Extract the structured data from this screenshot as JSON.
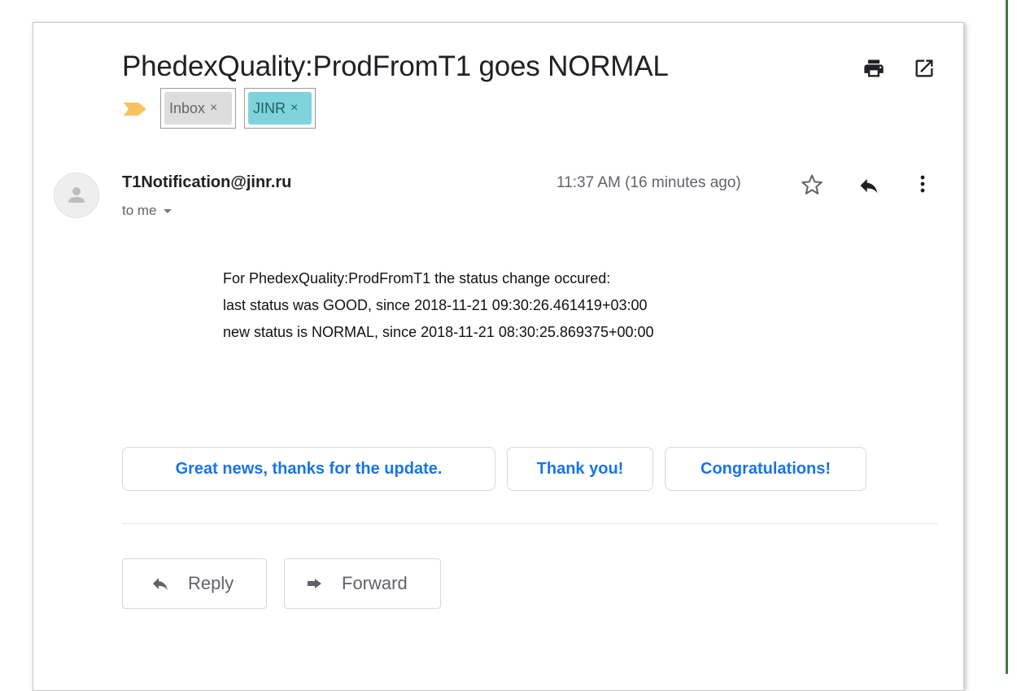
{
  "email": {
    "subject": "PhedexQuality:ProdFromT1 goes NORMAL",
    "labels": [
      {
        "name": "Inbox",
        "remove": "×",
        "color": "#dddddd"
      },
      {
        "name": "JINR",
        "remove": "×",
        "color": "#7fd3da"
      }
    ],
    "sender": "T1Notification@jinr.ru",
    "recipient": "to me",
    "timestamp": "11:37 AM (16 minutes ago)",
    "body_lines": [
      "For PhedexQuality:ProdFromT1 the status change occured:",
      "last status was GOOD, since 2018-11-21 09:30:26.461419+03:00",
      "new status is NORMAL, since 2018-11-21 08:30:25.869375+00:00"
    ]
  },
  "smart_replies": [
    "Great news, thanks for the update.",
    "Thank you!",
    "Congratulations!"
  ],
  "actions": {
    "reply": "Reply",
    "forward": "Forward"
  },
  "icons": {
    "print": "print-icon",
    "popout": "open-in-new-window-icon",
    "importance": "importance-marker-icon",
    "star": "star-icon",
    "reply": "reply-icon",
    "more": "more-vert-icon"
  },
  "colors": {
    "accent_blue": "#1a73e8",
    "importance": "#f7c25d",
    "frame_green": "#3e7a43"
  }
}
